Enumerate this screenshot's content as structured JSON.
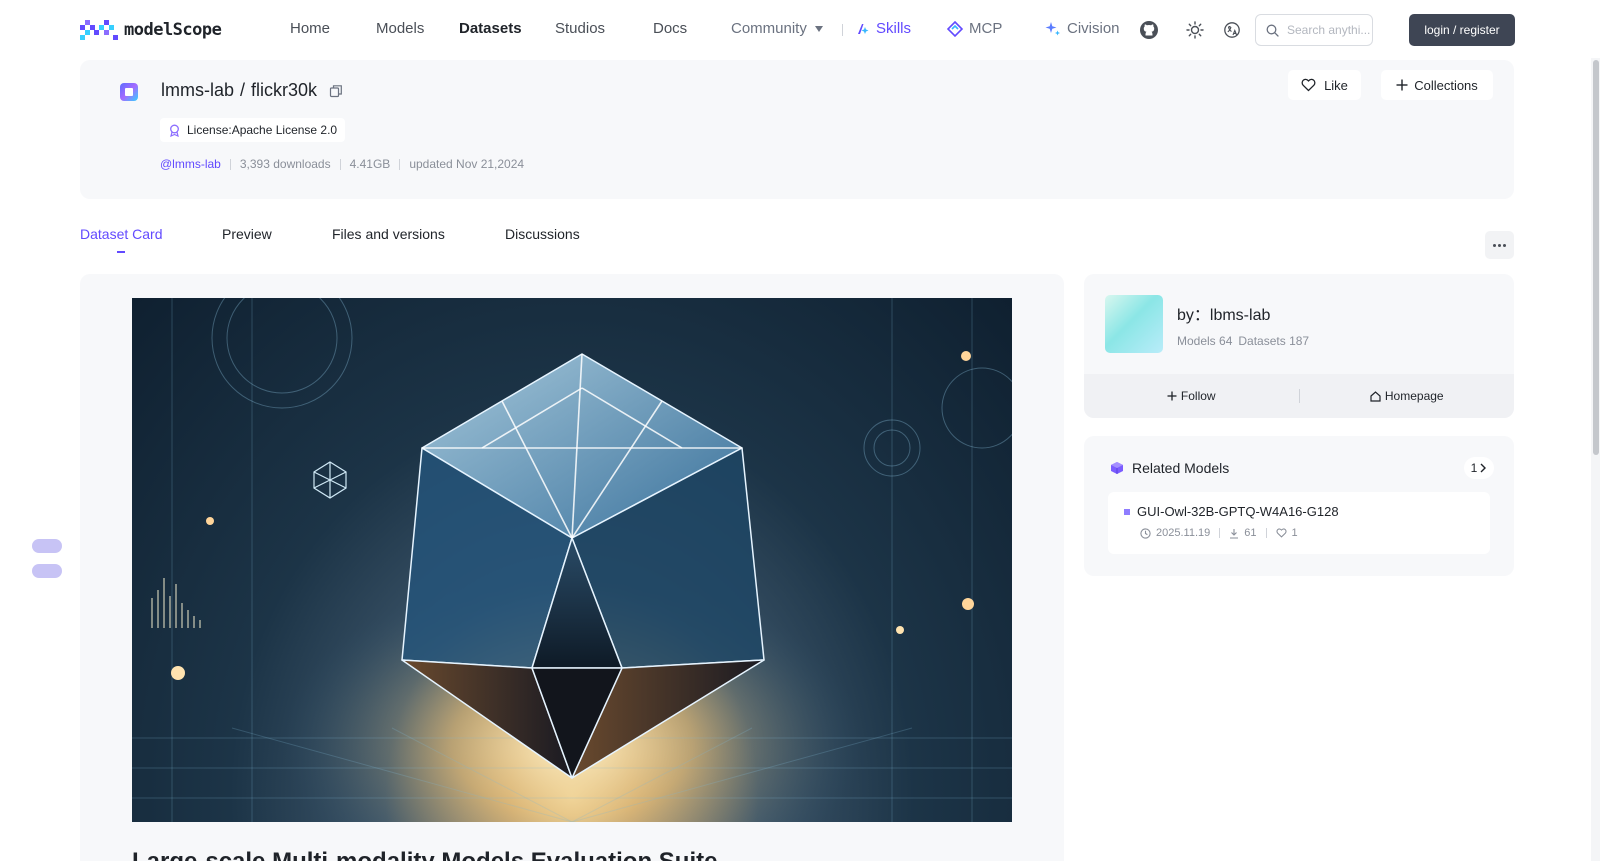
{
  "header": {
    "logo_text": "modelScope",
    "nav": {
      "home": "Home",
      "models": "Models",
      "datasets": "Datasets",
      "studios": "Studios",
      "docs": "Docs",
      "community": "Community",
      "skills": "Skills",
      "mcp": "MCP",
      "civision": "Civision"
    },
    "active_nav": "Datasets",
    "search_placeholder": "Search anythi...",
    "login_label": "login / register"
  },
  "dataset": {
    "owner": "lmms-lab",
    "separator": "/",
    "name": "flickr30k",
    "license": "License:Apache License 2.0",
    "owner_handle": "@lmms-lab",
    "downloads": "3,393 downloads",
    "size": "4.41GB",
    "updated": "updated Nov 21,2024",
    "like_label": "Like",
    "collections_label": "Collections"
  },
  "tabs": {
    "dataset_card": "Dataset Card",
    "preview": "Preview",
    "files": "Files and versions",
    "discussions": "Discussions",
    "active": "Dataset Card"
  },
  "main": {
    "heading": "Large-scale Multi-modality Models Evaluation Suite"
  },
  "owner_card": {
    "by_label": "by：lbms-lab",
    "models": "Models 64",
    "datasets": "Datasets 187",
    "follow_label": "Follow",
    "homepage_label": "Homepage"
  },
  "related_models": {
    "title": "Related Models",
    "count": "1",
    "items": [
      {
        "name": "GUI-Owl-32B-GPTQ-W4A16-G128",
        "date": "2025.11.19",
        "downloads": "61",
        "likes": "1"
      }
    ]
  },
  "colors": {
    "accent": "#624aff",
    "login_bg": "#3e4554",
    "card_bg": "#f7f8fa"
  }
}
